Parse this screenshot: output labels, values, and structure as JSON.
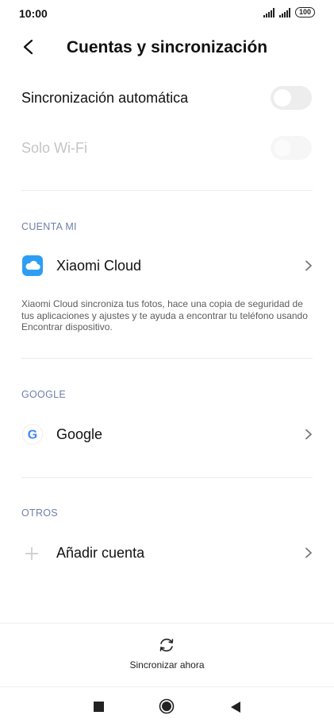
{
  "status": {
    "time": "10:00",
    "battery": "100"
  },
  "header": {
    "title": "Cuentas y sincronización"
  },
  "settings": {
    "auto_sync": {
      "label": "Sincronización automática",
      "enabled": false
    },
    "wifi_only": {
      "label": "Solo Wi-Fi",
      "enabled": false,
      "disabled": true
    }
  },
  "sections": {
    "cuenta_mi": {
      "header": "CUENTA MI",
      "item_label": "Xiaomi Cloud",
      "description": "Xiaomi Cloud sincroniza tus fotos, hace una copia de seguridad de tus aplicaciones y ajustes y te ayuda a encontrar tu teléfono usando Encontrar dispositivo."
    },
    "google": {
      "header": "GOOGLE",
      "item_label": "Google"
    },
    "otros": {
      "header": "OTROS",
      "item_label": "Añadir cuenta"
    }
  },
  "footer": {
    "sync_label": "Sincronizar ahora"
  },
  "icons": {
    "back": "back-arrow-icon",
    "cloud": "xiaomi-cloud-icon",
    "google": "google-g-icon",
    "add": "plus-icon",
    "chevron": "chevron-right-icon",
    "sync": "sync-icon"
  },
  "colors": {
    "section_header": "#6f7fa8",
    "cloud_blue": "#2e9ef4",
    "toggle_off": "#ededed",
    "disabled_text": "#c4c4c4"
  }
}
